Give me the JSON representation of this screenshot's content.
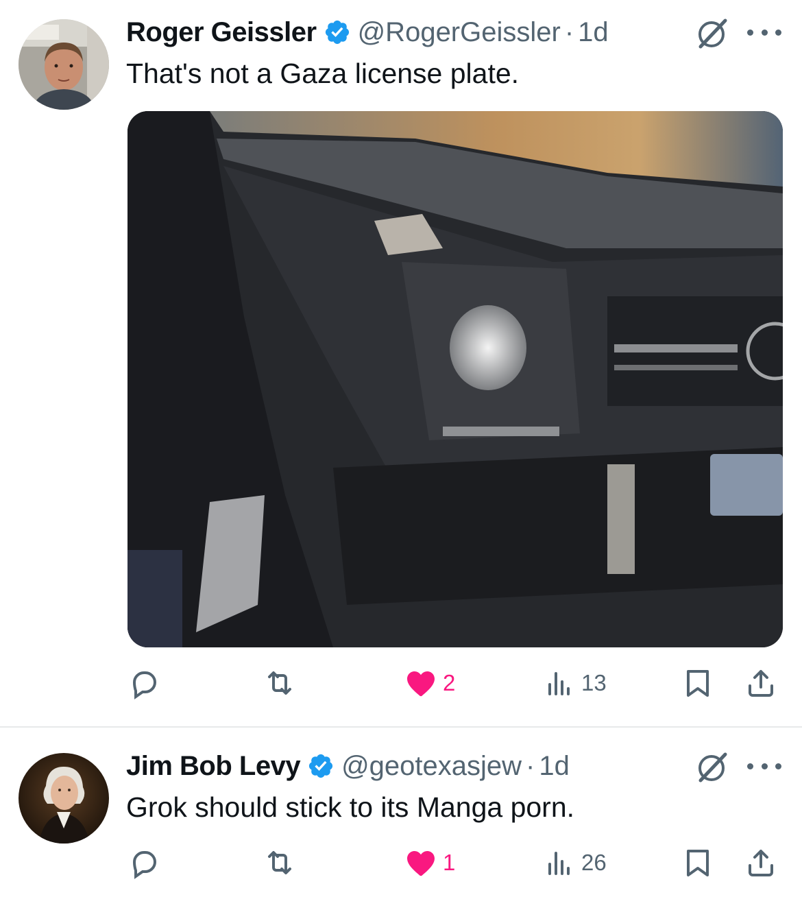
{
  "tweets": [
    {
      "display_name": "Roger Geissler",
      "handle": "@RogerGeissler",
      "separator": "·",
      "time": "1d",
      "text": "That's not a Gaza license plate.",
      "has_media": true,
      "actions": {
        "replies": "",
        "reposts": "",
        "likes": "2",
        "views": "13"
      }
    },
    {
      "display_name": "Jim Bob Levy",
      "handle": "@geotexasjew",
      "separator": "·",
      "time": "1d",
      "text": "Grok should stick to its Manga porn.",
      "has_media": false,
      "actions": {
        "replies": "",
        "reposts": "",
        "likes": "1",
        "views": "26"
      }
    }
  ],
  "colors": {
    "verified": "#1d9bf0",
    "like": "#f91880",
    "secondary_text": "#536471",
    "primary_text": "#0f1419",
    "divider": "#e7e9ea"
  },
  "icons": [
    "verified-badge-icon",
    "grok-icon",
    "more-icon",
    "reply-icon",
    "repost-icon",
    "heart-icon",
    "views-icon",
    "bookmark-icon",
    "share-icon"
  ]
}
